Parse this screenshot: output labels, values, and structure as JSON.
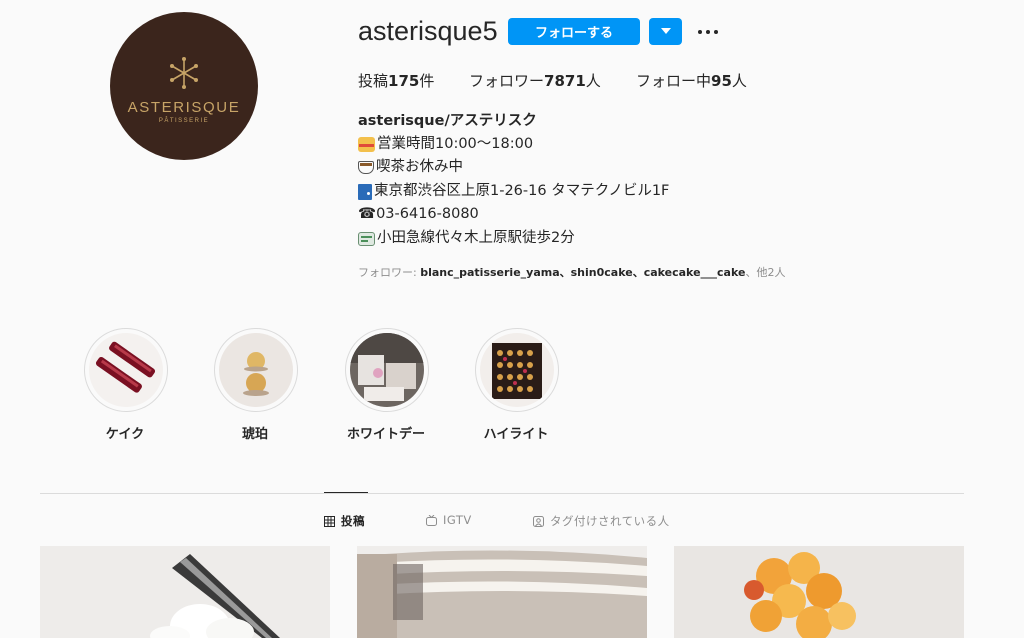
{
  "profile": {
    "username": "asterisque5",
    "follow_label": "フォローする",
    "avatar_brand": "ASTERISQUE",
    "avatar_sub": "PÂTISSERIE"
  },
  "stats": {
    "posts_prefix": "投稿",
    "posts_count": "175",
    "posts_suffix": "件",
    "followers_prefix": "フォロワー",
    "followers_count": "7871",
    "followers_suffix": "人",
    "following_prefix": "フォロー中",
    "following_count": "95",
    "following_suffix": "人"
  },
  "bio": {
    "name": "asterisque/アステリスク",
    "lines": [
      {
        "icon": "cake-icon",
        "text": "営業時間10:00～18:00"
      },
      {
        "icon": "coffee-cup-icon",
        "text": "喫茶お休み中"
      },
      {
        "icon": "door-icon",
        "text": "東京都渋谷区上原1-26-16 タマテクノビル1F"
      },
      {
        "icon": "phone-icon",
        "text": "03-6416-8080"
      },
      {
        "icon": "train-ticket-icon",
        "text": "小田急線代々木上原駅徒歩2分"
      }
    ],
    "phone_glyph": "☎"
  },
  "followed_by": {
    "prefix": "フォロワー: ",
    "names": "blanc_patisserie_yama、shin0cake、cakecake___cake",
    "suffix": "、他2人"
  },
  "highlights": [
    {
      "label": "ケイク"
    },
    {
      "label": "琥珀"
    },
    {
      "label": "ホワイトデー"
    },
    {
      "label": "ハイライト"
    }
  ],
  "tabs": [
    {
      "label": "投稿",
      "icon": "grid-icon",
      "active": true
    },
    {
      "label": "IGTV",
      "icon": "tv-icon",
      "active": false
    },
    {
      "label": "タグ付けされている人",
      "icon": "tagged-user-icon",
      "active": false
    }
  ],
  "colors": {
    "primary_button": "#0095f6",
    "avatar_bg": "#3b251c",
    "brand_gold": "#c7a467"
  }
}
